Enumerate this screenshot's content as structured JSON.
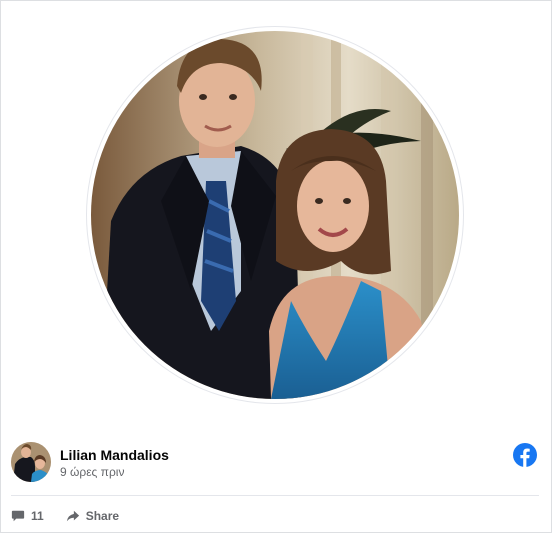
{
  "post": {
    "author": {
      "name": "Lilian Mandalios",
      "time": "9 ώρες πριν"
    },
    "photo": {
      "description": "profile-photo"
    },
    "actions": {
      "comments_count": "11",
      "share_label": "Share"
    }
  },
  "icons": {
    "comment": "comment-icon",
    "share": "share-icon",
    "logo": "facebook-logo-icon"
  },
  "colors": {
    "facebook_blue": "#1877f2",
    "name_text": "#050505",
    "muted_text": "#65676b",
    "divider": "#e4e6eb"
  }
}
